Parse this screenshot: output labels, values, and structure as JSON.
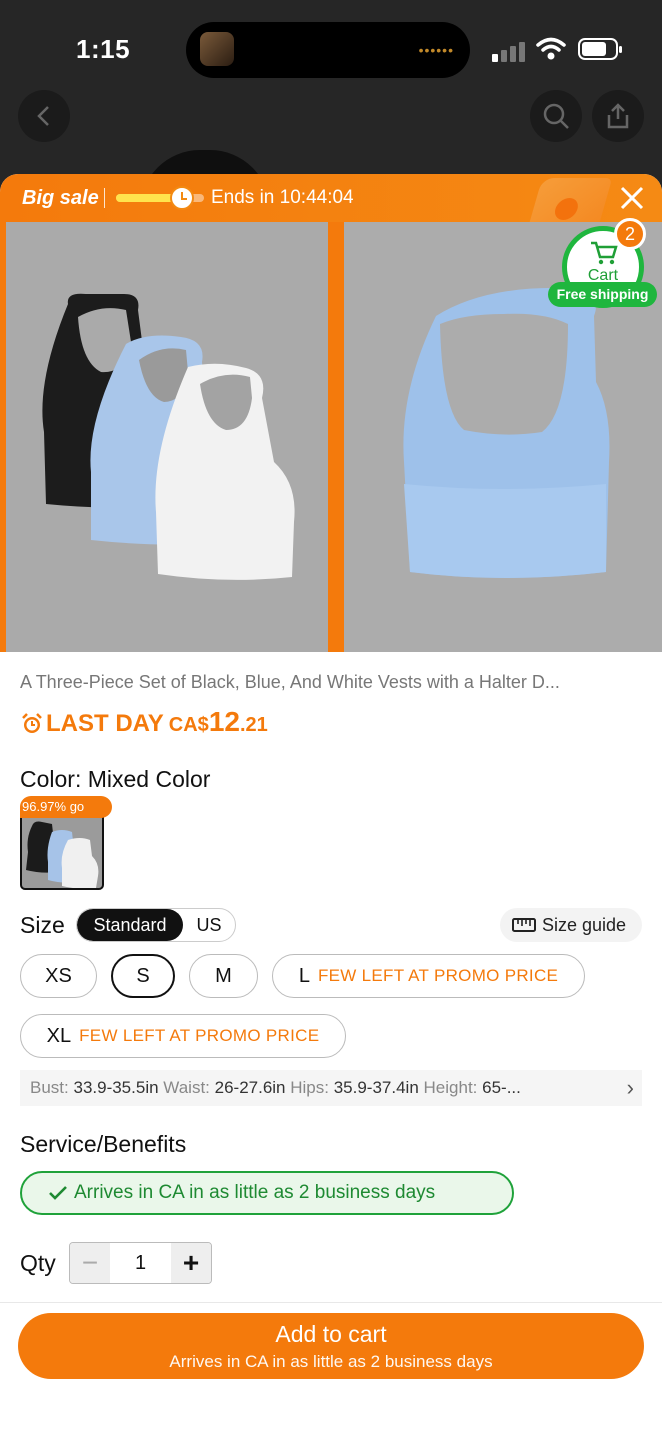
{
  "status_bar": {
    "time": "1:15"
  },
  "sale_bar": {
    "title": "Big sale",
    "ends_label": "Ends in",
    "countdown": "10:44:04",
    "progress": 0.7
  },
  "cart": {
    "label": "Cart",
    "count": "2",
    "free_shipping": "Free shipping"
  },
  "product": {
    "title": "A Three-Piece Set of Black, Blue, And White Vests with a Halter D...",
    "last_day": "LAST DAY",
    "currency": "CA$",
    "price_int": "12",
    "price_dec": ".21"
  },
  "color": {
    "label": "Color: Mixed Color",
    "swatch_tag": "96.97% go"
  },
  "size": {
    "label": "Size",
    "toggle": [
      "Standard",
      "US"
    ],
    "guide": "Size guide",
    "options": [
      {
        "label": "XS",
        "note": ""
      },
      {
        "label": "S",
        "note": ""
      },
      {
        "label": "M",
        "note": ""
      },
      {
        "label": "L",
        "note": "FEW LEFT AT PROMO PRICE"
      },
      {
        "label": "XL",
        "note": "FEW LEFT AT PROMO PRICE"
      }
    ],
    "selected": "S",
    "measurements": {
      "bust_label": "Bust:",
      "bust": "33.9-35.5in",
      "waist_label": "Waist:",
      "waist": "26-27.6in",
      "hips_label": "Hips:",
      "hips": "35.9-37.4in",
      "height_label": "Height:",
      "height": "65-..."
    }
  },
  "service": {
    "label": "Service/Benefits",
    "arrival": "Arrives in CA in as little as 2 business days"
  },
  "qty": {
    "label": "Qty",
    "value": "1",
    "minus": "−",
    "plus": "+"
  },
  "add_to_cart": {
    "label": "Add to cart",
    "sub": "Arrives in CA in as little as 2 business days"
  },
  "colors": {
    "accent": "#f47a0c",
    "green": "#1fb63e"
  }
}
